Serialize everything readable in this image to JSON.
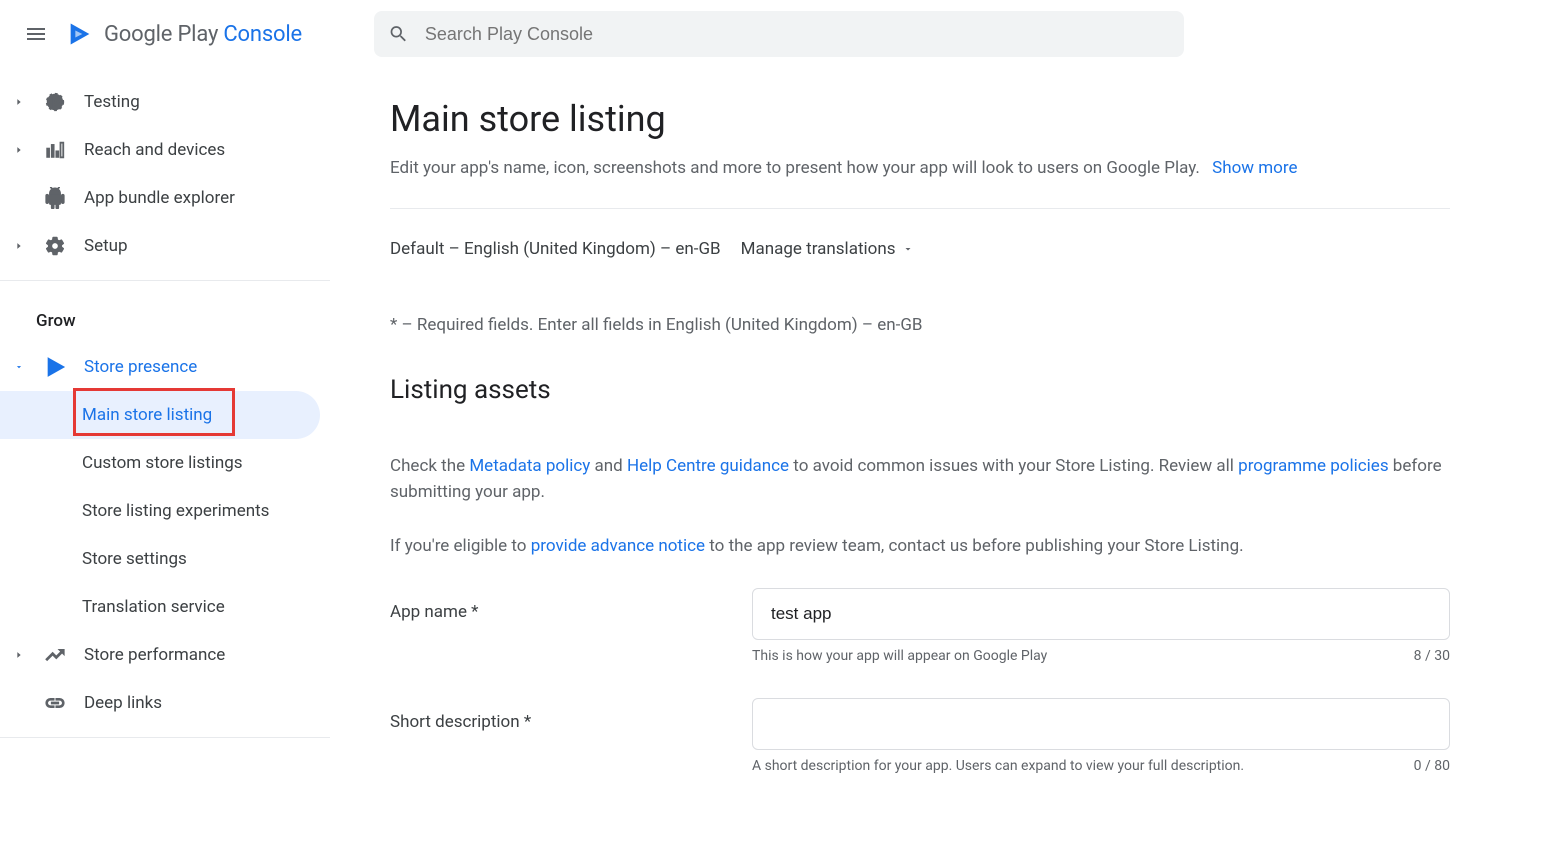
{
  "header": {
    "logo_name": "Google Play",
    "logo_console": " Console",
    "search_placeholder": "Search Play Console"
  },
  "sidebar": {
    "top": [
      {
        "label": "Testing",
        "icon": "target"
      },
      {
        "label": "Reach and devices",
        "icon": "bars"
      },
      {
        "label": "App bundle explorer",
        "icon": "android"
      },
      {
        "label": "Setup",
        "icon": "gear"
      }
    ],
    "section_label": "Grow",
    "store_presence": {
      "label": "Store presence"
    },
    "sub": [
      {
        "label": "Main store listing"
      },
      {
        "label": "Custom store listings"
      },
      {
        "label": "Store listing experiments"
      },
      {
        "label": "Store settings"
      },
      {
        "label": "Translation service"
      }
    ],
    "store_perf": {
      "label": "Store performance"
    },
    "deep_links": {
      "label": "Deep links"
    }
  },
  "page": {
    "title": "Main store listing",
    "subtitle": "Edit your app's name, icon, screenshots and more to present how your app will look to users on Google Play.",
    "show_more": "Show more",
    "lang_label": "Default – English (United Kingdom) – en-GB",
    "manage_translations": "Manage translations",
    "required_note": "* – Required fields. Enter all fields in English (United Kingdom) – en-GB",
    "section_title": "Listing assets",
    "p1_a": "Check the ",
    "p1_link1": "Metadata policy",
    "p1_b": " and ",
    "p1_link2": "Help Centre guidance",
    "p1_c": " to avoid common issues with your Store Listing. Review all ",
    "p1_link3": "programme policies",
    "p1_d": " before submitting your app.",
    "p2_a": "If you're eligible to ",
    "p2_link1": "provide advance notice",
    "p2_b": " to the app review team, contact us before publishing your Store Listing.",
    "fields": {
      "app_name": {
        "label": "App name  *",
        "value": "test app",
        "helper": "This is how your app will appear on Google Play",
        "counter": "8 / 30"
      },
      "short_desc": {
        "label": "Short description  *",
        "value": "",
        "helper": "A short description for your app. Users can expand to view your full description.",
        "counter": "0 / 80"
      }
    }
  }
}
